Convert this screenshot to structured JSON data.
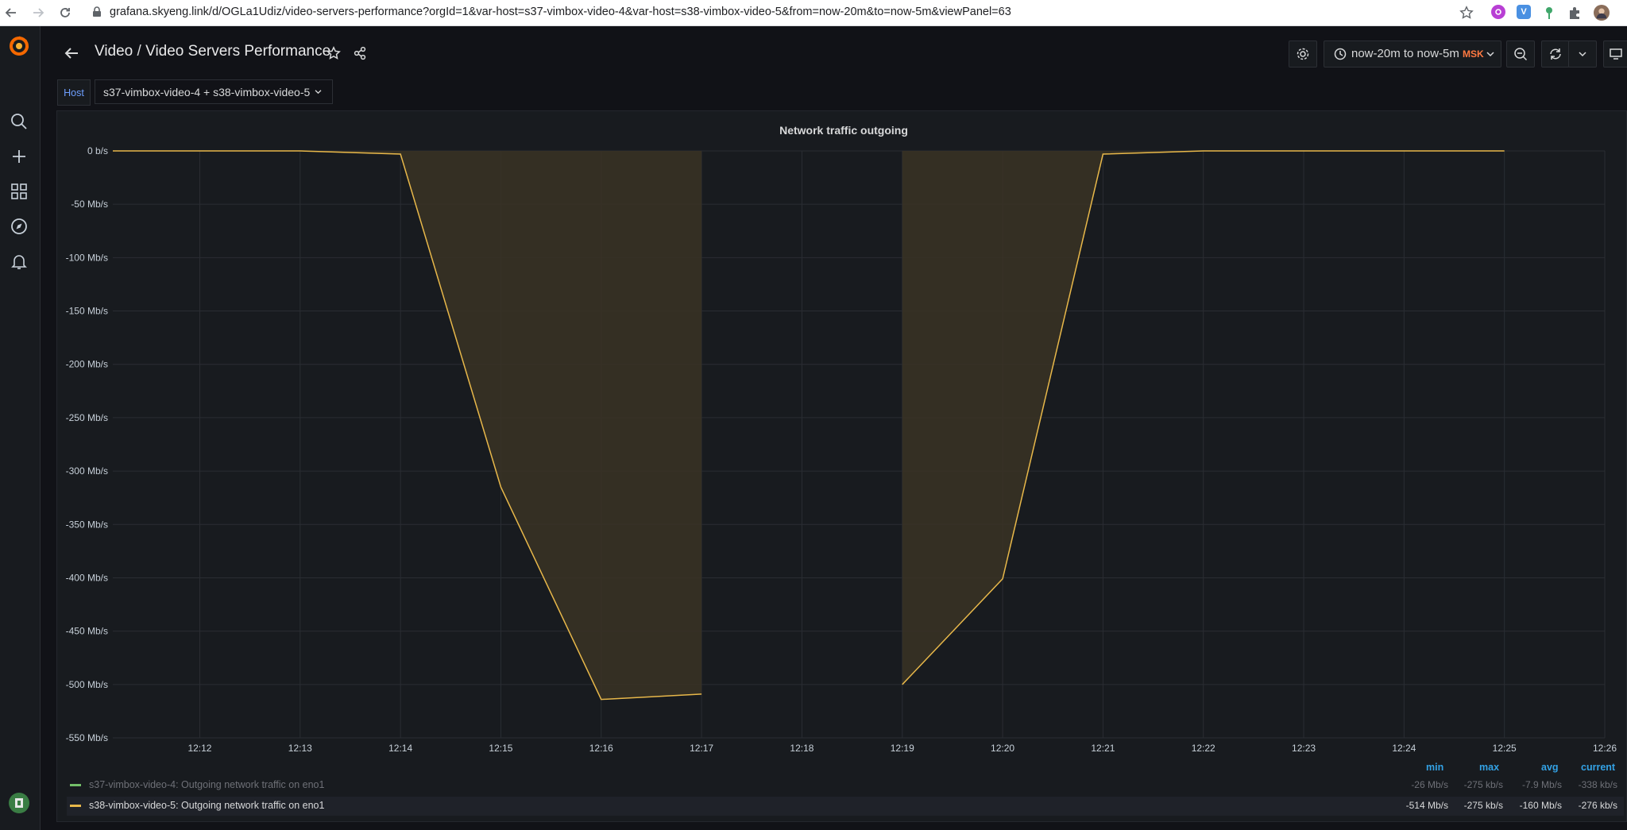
{
  "browser": {
    "url": "grafana.skyeng.link/d/OGLa1Udiz/video-servers-performance?orgId=1&var-host=s37-vimbox-video-4&var-host=s38-vimbox-video-5&from=now-20m&to=now-5m&viewPanel=63",
    "extensions": [
      "V"
    ]
  },
  "header": {
    "folder": "Video",
    "separator": "/",
    "title": "Video Servers Performance",
    "time_range": "now-20m to now-5m",
    "timezone": "MSK"
  },
  "variables": {
    "host_label": "Host",
    "host_value": "s37-vimbox-video-4 + s38-vimbox-video-5"
  },
  "colors": {
    "series_1": "#73bf69",
    "series_2": "#e8b84a",
    "fill": "#3a3324",
    "grafana_logo": "#f46800"
  },
  "panel": {
    "title": "Network traffic outgoing"
  },
  "legend": {
    "headers": [
      "min",
      "max",
      "avg",
      "current"
    ],
    "rows": [
      {
        "name": "s37-vimbox-video-4: Outgoing network traffic on eno1",
        "min": "-26 Mb/s",
        "max": "-275 kb/s",
        "avg": "-7.9 Mb/s",
        "current": "-338 kb/s"
      },
      {
        "name": "s38-vimbox-video-5: Outgoing network traffic on eno1",
        "min": "-514 Mb/s",
        "max": "-275 kb/s",
        "avg": "-160 Mb/s",
        "current": "-276 kb/s"
      }
    ]
  },
  "chart_data": {
    "type": "area",
    "title": "Network traffic outgoing",
    "x_ticks": [
      "12:12",
      "12:13",
      "12:14",
      "12:15",
      "12:16",
      "12:17",
      "12:18",
      "12:19",
      "12:20",
      "12:21",
      "12:22",
      "12:23",
      "12:24",
      "12:25",
      "12:26"
    ],
    "y_ticks": [
      "0 b/s",
      "-50 Mb/s",
      "-100 Mb/s",
      "-150 Mb/s",
      "-200 Mb/s",
      "-250 Mb/s",
      "-300 Mb/s",
      "-350 Mb/s",
      "-400 Mb/s",
      "-450 Mb/s",
      "-500 Mb/s",
      "-550 Mb/s"
    ],
    "ylim": [
      -550,
      0
    ],
    "grid": true,
    "legend_placement": "bottom",
    "series": [
      {
        "name": "s38-vimbox-video-5: Outgoing network traffic on eno1",
        "color": "#e8b84a",
        "segments": [
          [
            [
              "12:11:08",
              0
            ],
            [
              "12:12",
              0
            ],
            [
              "12:13",
              0
            ],
            [
              "12:14",
              -3
            ],
            [
              "12:15",
              -315
            ],
            [
              "12:16",
              -514
            ],
            [
              "12:17",
              -509
            ]
          ],
          [
            [
              "12:19",
              -500
            ],
            [
              "12:20",
              -401
            ],
            [
              "12:21",
              -3
            ],
            [
              "12:22",
              0
            ],
            [
              "12:23",
              0
            ],
            [
              "12:24",
              0
            ],
            [
              "12:25",
              0
            ]
          ]
        ]
      }
    ]
  }
}
